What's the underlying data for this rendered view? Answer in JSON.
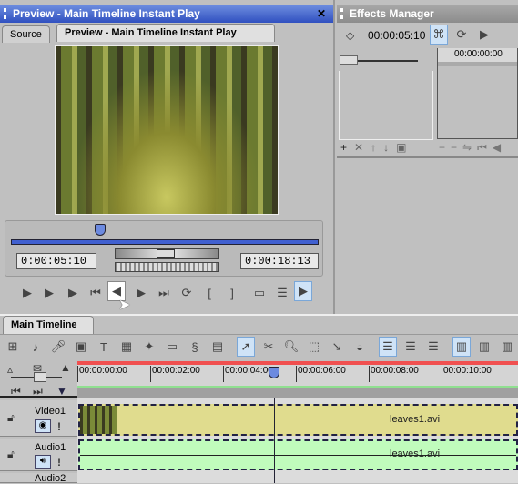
{
  "preview": {
    "title": "Preview - Main Timeline Instant Play",
    "close": "✕",
    "tabs": [
      {
        "label": "Source"
      },
      {
        "label": "Preview - Main Timeline Instant Play"
      }
    ],
    "position_fraction": 0.29,
    "timecode_current": "0:00:05:10",
    "timecode_duration": "0:00:18:13",
    "controls": [
      "play",
      "play-in-out",
      "play-to-end",
      "go-start",
      "prev-frame",
      "next-frame",
      "go-end",
      "loop",
      "mark-in",
      "mark-out",
      "safe-area",
      "info",
      "instant-play"
    ]
  },
  "effects": {
    "title": "Effects Manager",
    "timecode": "00:00:05:10",
    "ruler_label": "00:00:00:00",
    "bottom_left": [
      "+",
      "✕",
      "↑",
      "↓",
      "▣"
    ],
    "bottom_right": [
      "+",
      "−",
      "⇋",
      "⏮",
      "◀"
    ]
  },
  "timeline": {
    "tab": "Main Timeline",
    "ruler": [
      "00:00:00:00",
      "00:00:02:00",
      "00:00:04:00",
      "00:00:06:00",
      "00:00:08:00",
      "00:00:10:00"
    ],
    "tools": [
      "add-video",
      "add-audio",
      "add-narration",
      "add-image",
      "add-title",
      "add-color",
      "add-effect",
      "add-dvd",
      "add-transition",
      "add-clip",
      "select",
      "razor",
      "zoom",
      "marquee",
      "slip",
      "meter",
      "view-1",
      "view-2",
      "view-3",
      "layout-1",
      "layout-2",
      "layout-3"
    ],
    "tracks": [
      {
        "name": "Video1",
        "clip": "leaves1.avi",
        "color": "#e0dc8e"
      },
      {
        "name": "Audio1",
        "clip": "leaves1.avi",
        "color": "#c0fcbc"
      },
      {
        "name": "Audio2"
      }
    ]
  }
}
